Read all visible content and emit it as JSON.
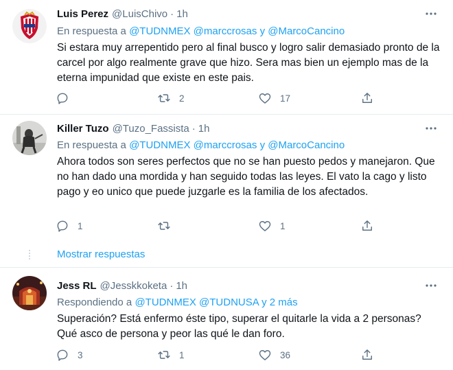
{
  "tweets": [
    {
      "name": "Luis Perez",
      "handle": "@LuisChivo",
      "dot": "·",
      "time": "1h",
      "reply_prefix": "En respuesta a",
      "mention_1": "@TUDNMEX",
      "mention_2": "@marccrosas",
      "joiner": "y",
      "mention_3": "@MarcoCancino",
      "text": "Si estara muy arrepentido pero al final busco y logro salir demasiado pronto de la carcel por algo realmente grave que hizo. Sera mas bien un ejemplo mas de la eterna impunidad que existe en este pais.",
      "replies": "",
      "retweets": "2",
      "likes": "17"
    },
    {
      "name": "Killer Tuzo",
      "handle": "@Tuzo_Fassista",
      "dot": "·",
      "time": "1h",
      "reply_prefix": "En respuesta a",
      "mention_1": "@TUDNMEX",
      "mention_2": "@marccrosas",
      "joiner": "y",
      "mention_3": "@MarcoCancino",
      "text": "Ahora todos son seres perfectos que no se han puesto pedos y manejaron. Que no han dado una mordida y han seguido todas las leyes. El vato la cago y listo pago y eo unico que puede juzgarle es la familia de los afectados.",
      "replies": "1",
      "retweets": "",
      "likes": "1"
    },
    {
      "name": "Jess RL",
      "handle": "@Jesskkoketa",
      "dot": "·",
      "time": "1h",
      "reply_prefix": "Respondiendo a",
      "mention_1": "@TUDNMEX",
      "mention_2": "@TUDNUSA",
      "joiner": "y 2 más",
      "mention_3": "",
      "text": "Superación? Está enfermo éste tipo, superar el quitarle la vida a 2 personas? Qué asco de persona y peor las qué le dan foro.",
      "replies": "3",
      "retweets": "1",
      "likes": "36"
    }
  ],
  "show_replies": "Mostrar respuestas",
  "colors": {
    "link": "#1da1f2",
    "muted": "#5b7083",
    "text": "#0f1419",
    "divider": "#e6ecf0"
  },
  "icons": [
    "more-icon",
    "reply-icon",
    "retweet-icon",
    "like-icon",
    "share-icon"
  ]
}
